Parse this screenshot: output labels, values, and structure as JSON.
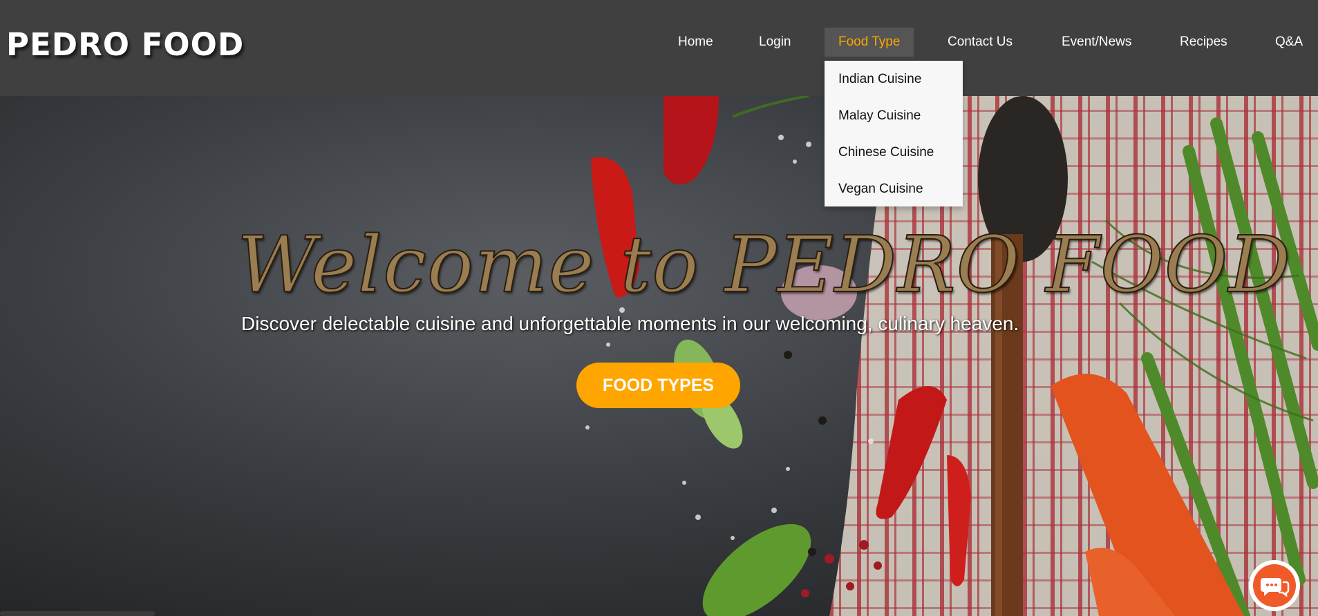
{
  "header": {
    "logo": "PEDRO FOOD",
    "nav": {
      "home": "Home",
      "login": "Login",
      "food_type": "Food Type",
      "contact": "Contact Us",
      "events": "Event/News",
      "recipes": "Recipes",
      "qa": "Q&A"
    },
    "active_item": "Food Type",
    "accent_color": "#ffa500"
  },
  "dropdown": {
    "items": [
      "Indian Cuisine",
      "Malay Cuisine",
      "Chinese Cuisine",
      "Vegan Cuisine"
    ]
  },
  "hero": {
    "title": "Welcome to PEDRO FOOD",
    "subtitle": "Discover delectable cuisine and unforgettable moments in our welcoming, culinary heaven.",
    "button_label": "FOOD TYPES",
    "button_color": "#ffa500"
  },
  "widgets": {
    "chat_icon": "chat-bubbles-icon",
    "chat_color": "#f05a28"
  }
}
